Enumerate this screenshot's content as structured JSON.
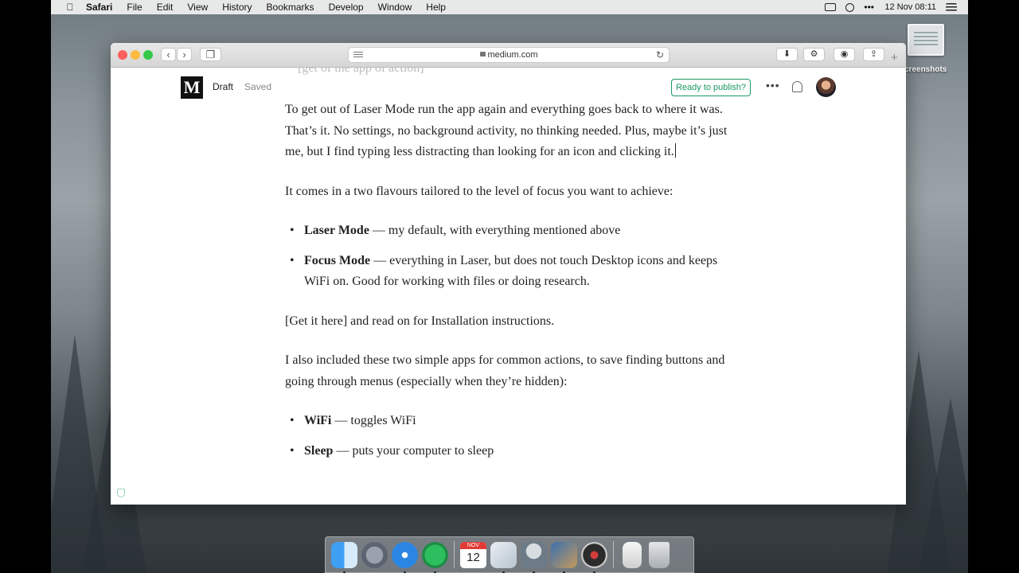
{
  "menubar": {
    "app": "Safari",
    "items": [
      "File",
      "Edit",
      "View",
      "History",
      "Bookmarks",
      "Develop",
      "Window",
      "Help"
    ],
    "datetime": "12 Nov  08:11",
    "status_icons": [
      "screen-record-icon",
      "night-shift-icon",
      "more-dots-icon",
      "notification-list-icon"
    ]
  },
  "desktop": {
    "file_label": "creenshots"
  },
  "browser": {
    "url": "medium.com",
    "buttons": [
      "back",
      "forward",
      "tabs",
      "download",
      "extension",
      "password",
      "share"
    ]
  },
  "page": {
    "logo": "M",
    "status_draft": "Draft",
    "status_saved": "Saved",
    "publish_label": "Ready to publish?",
    "more_label": "•••",
    "faded_top_line": "[get of the app of action]",
    "paragraphs": [
      {
        "text": "To get out of Laser Mode run the app again and everything goes back to where it was. That’s it. No settings, no background activity, no thinking needed. Plus, maybe it’s just me, but I find typing less distracting than looking for an icon and clicking it."
      },
      {
        "text": "It comes in a two flavours tailored to the level of focus you want to achieve:"
      }
    ],
    "list1": [
      {
        "bold": "Laser Mode",
        "rest": " — my default, with everything mentioned above"
      },
      {
        "bold": "Focus Mode",
        "rest": " — everything in Laser, but does not touch Desktop icons and keeps WiFi on. Good for working with files or doing research."
      }
    ],
    "para3": "[Get it here] and read on for Installation instructions.",
    "para4": "I also included these two simple apps for common actions, to save finding buttons and going through menus (especially when they’re hidden):",
    "list2": [
      {
        "bold": "WiFi",
        "rest": " — toggles WiFi"
      },
      {
        "bold": "Sleep",
        "rest": " — puts your computer to sleep"
      }
    ]
  },
  "dock": {
    "calendar_month": "NOV",
    "calendar_day": "12",
    "apps": [
      "finder-icon",
      "launchpad-icon",
      "safari-icon",
      "evernote-icon",
      "calendar-icon",
      "mail-icon",
      "automator-icon",
      "preview-icon",
      "photo-booth-icon",
      "document-icon",
      "trash-icon"
    ]
  },
  "colors": {
    "accent_green": "#1c9963",
    "close": "#fc605c",
    "minimize": "#fdbc40",
    "zoom": "#34c84a"
  }
}
